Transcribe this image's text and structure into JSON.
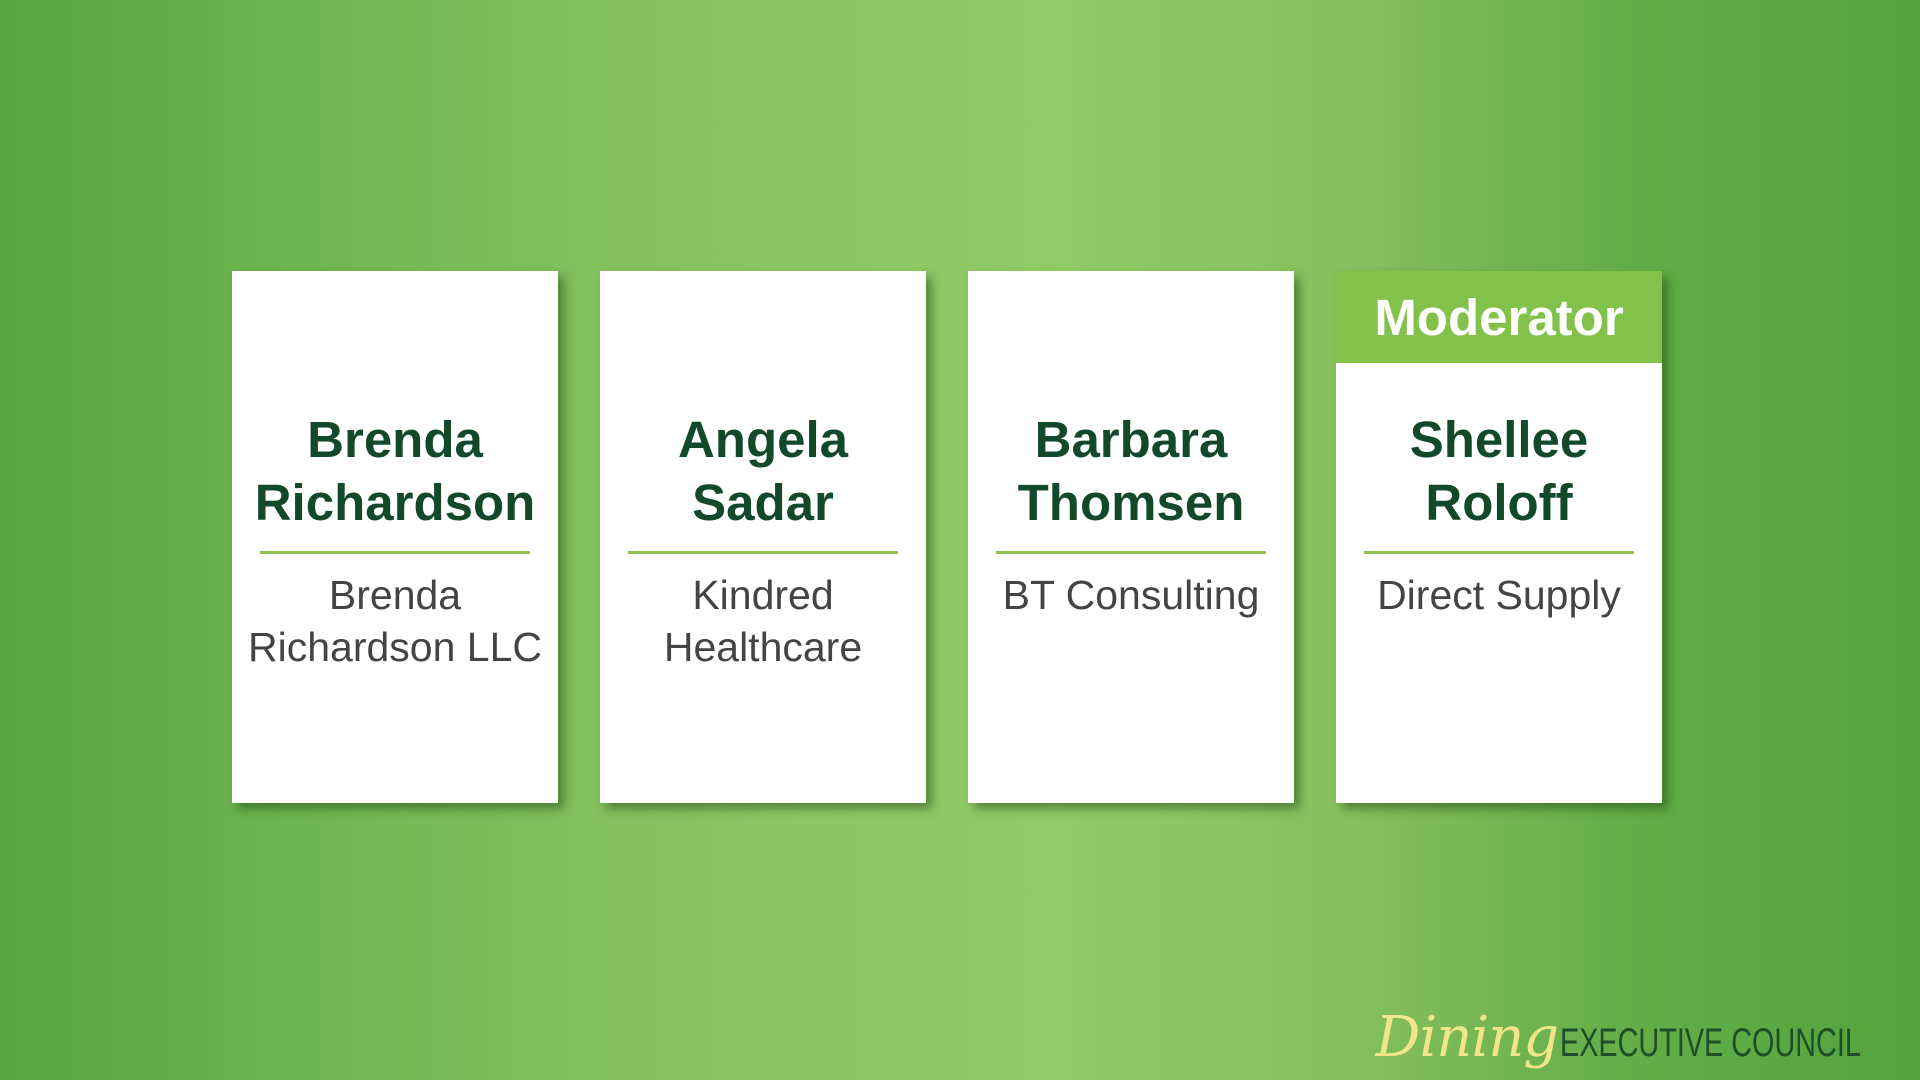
{
  "panelists": [
    {
      "name_lines": [
        "Brenda",
        "Richardson"
      ],
      "org_lines": [
        "Brenda",
        "Richardson LLC"
      ]
    },
    {
      "name_lines": [
        "Angela",
        "Sadar"
      ],
      "org_lines": [
        "Kindred",
        "Healthcare"
      ]
    },
    {
      "name_lines": [
        "Barbara",
        "Thomsen"
      ],
      "org_lines": [
        "BT Consulting"
      ]
    },
    {
      "role": "Moderator",
      "name_lines": [
        "Shellee",
        "Roloff"
      ],
      "org_lines": [
        "Direct Supply"
      ]
    }
  ],
  "brand": {
    "script": "Dining",
    "caps": "EXECUTIVE COUNCIL"
  },
  "colors": {
    "background": "#8cc563",
    "card": "#ffffff",
    "name_text": "#11492a",
    "org_text": "#444444",
    "banner": "#83c24a",
    "divider": "#8dc451",
    "brand_script": "#f2e48a",
    "brand_caps": "#1f4f2a"
  }
}
